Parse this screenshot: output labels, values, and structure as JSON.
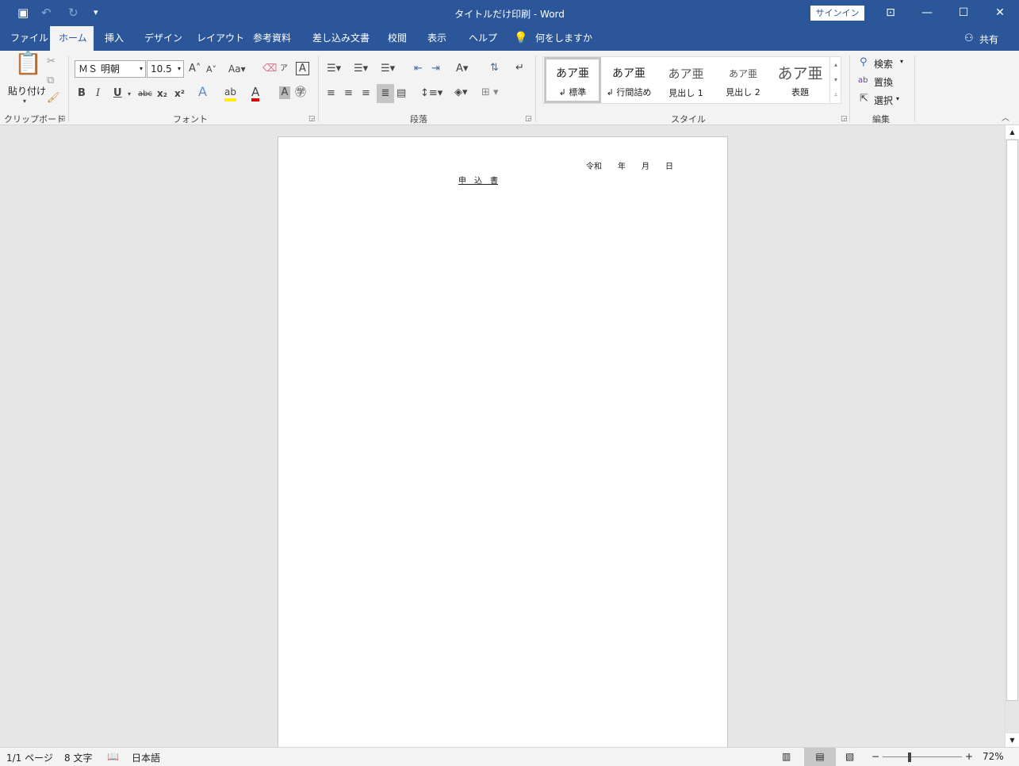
{
  "titlebar": {
    "title": "タイトルだけ印刷 - Word",
    "signin": "サインイン",
    "icons": [
      "save-icon",
      "undo-icon",
      "redo-icon",
      "customize-icon"
    ]
  },
  "tabs": [
    {
      "label": "ファイル"
    },
    {
      "label": "ホーム",
      "active": true
    },
    {
      "label": "挿入"
    },
    {
      "label": "デザイン"
    },
    {
      "label": "レイアウト"
    },
    {
      "label": "参考資料"
    },
    {
      "label": "差し込み文書"
    },
    {
      "label": "校閲"
    },
    {
      "label": "表示"
    },
    {
      "label": "ヘルプ"
    }
  ],
  "tell_me": "何をしますか",
  "share": "共有",
  "ribbon": {
    "clipboard": {
      "paste": "貼り付け",
      "label": "クリップボード"
    },
    "font": {
      "name": "ＭＳ 明朝",
      "size": "10.5",
      "change_case": "Aa",
      "bold": "B",
      "italic": "I",
      "underline": "U",
      "strike": "abc",
      "label": "フォント"
    },
    "paragraph": {
      "label": "段落"
    },
    "styles": {
      "items": [
        {
          "preview": "あア亜",
          "name": "↲ 標準"
        },
        {
          "preview": "あア亜",
          "name": "↲ 行間詰め"
        },
        {
          "preview": "あア亜",
          "name": "見出し 1"
        },
        {
          "preview": "あア亜",
          "name": "見出し 2"
        },
        {
          "preview": "あア亜",
          "name": "表題"
        }
      ],
      "label": "スタイル"
    },
    "editing": {
      "find": "検索",
      "replace": "置換",
      "select": "選択",
      "label": "編集"
    }
  },
  "document": {
    "date_line": [
      "令和",
      "年",
      "月",
      "日"
    ],
    "title": "申　込　書"
  },
  "status": {
    "page": "1/1 ページ",
    "words": "8 文字",
    "language": "日本語",
    "zoom": "72%",
    "zoom_percent": 72
  },
  "colors": {
    "brand": "#2b579a",
    "ribbon": "#f3f3f3",
    "canvas": "#e6e6e6"
  }
}
